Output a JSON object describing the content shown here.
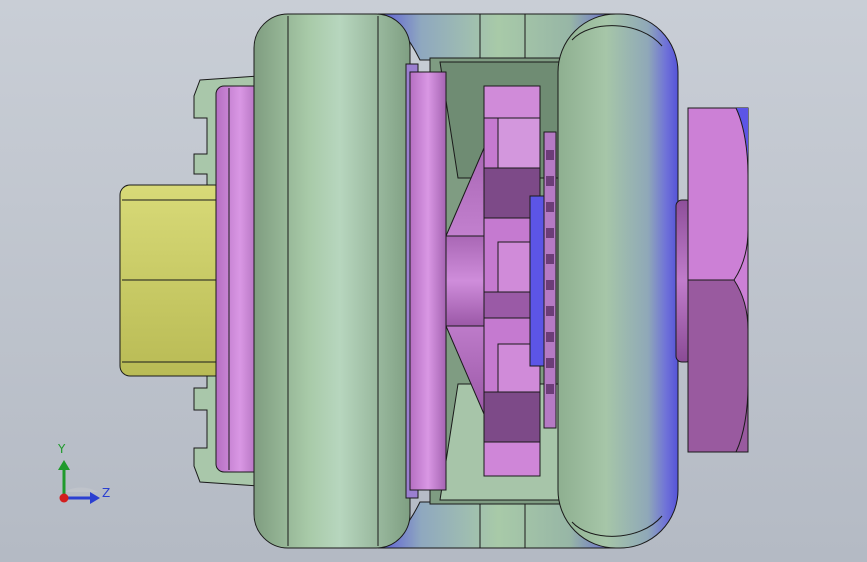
{
  "viewport": {
    "background_top": "#c9ced6",
    "background_bottom": "#b4bac4"
  },
  "model": {
    "parts": [
      {
        "name": "yellow-cylinder",
        "color": "#c9cc66"
      },
      {
        "name": "green-housing",
        "color": "#9fc3a0"
      },
      {
        "name": "magenta-ring",
        "color": "#c583d2"
      },
      {
        "name": "gear",
        "color": "#c57ad0"
      },
      {
        "name": "hex-nut",
        "color": "#cc80d6"
      },
      {
        "name": "blue-highlight",
        "color": "#5c55e6"
      }
    ]
  },
  "triad": {
    "y_label": "Y",
    "z_label": "Z",
    "y_color": "#1f9a2c",
    "z_color": "#2a3fd1",
    "origin_color": "#d21e1e"
  }
}
